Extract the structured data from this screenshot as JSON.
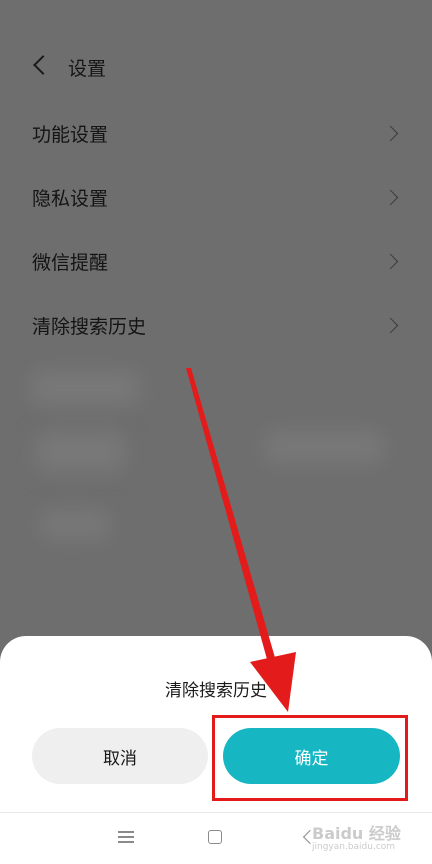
{
  "header": {
    "title": "设置"
  },
  "menu": [
    {
      "label": "功能设置"
    },
    {
      "label": "隐私设置"
    },
    {
      "label": "微信提醒"
    },
    {
      "label": "清除搜索历史"
    }
  ],
  "dialog": {
    "title": "清除搜索历史",
    "cancel_label": "取消",
    "confirm_label": "确定"
  },
  "watermark": {
    "brand": "Baidu 经验",
    "url": "jingyan.baidu.com"
  },
  "colors": {
    "accent": "#16b6c3",
    "annotation": "#e31b1b",
    "overlay": "#6e6e6e"
  },
  "icons": {
    "back": "chevron-left-icon",
    "row": "chevron-right-icon",
    "nav_menu": "menu-icon",
    "nav_home": "home-icon",
    "nav_back": "back-icon"
  }
}
